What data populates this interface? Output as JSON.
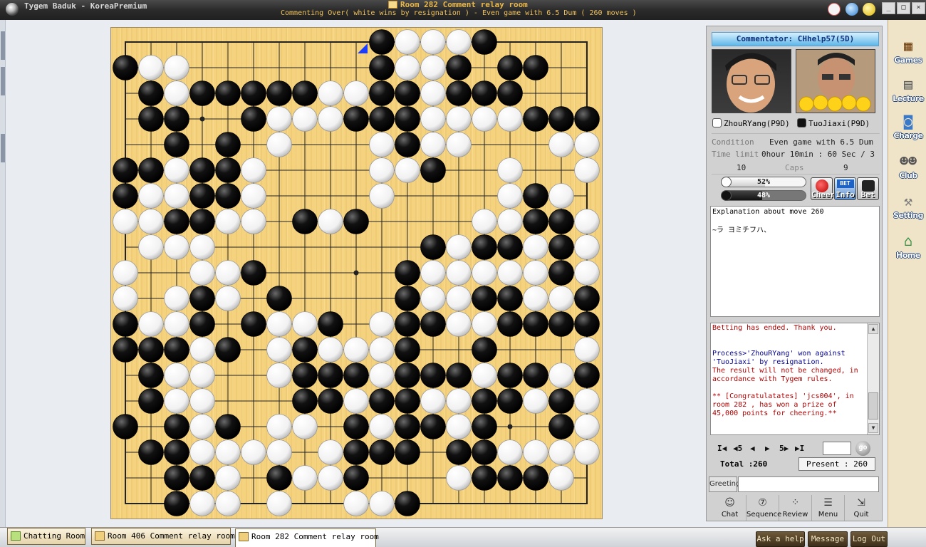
{
  "window": {
    "app_title": "Tygem Baduk - KoreaPremium",
    "room_title": "Room 282 Comment relay room",
    "room_subtitle": "Commenting Over( white wins by resignation ) - Even game with 6.5 Dum  ( 260 moves )"
  },
  "board": {
    "size": 19,
    "last_move": {
      "col": 9,
      "row": 0
    },
    "rows": [
      "..........BWWWB....",
      "BWW.......BWWB.BB..",
      ".BWBBBBBWWBBWBBB...",
      ".BB..BWWWBBBWWWWBBB",
      "..B.B.W...WBWW...WWB",
      "BBWBBW....WWB..W..WW",
      "BWWBBW....W....WBW..W",
      "WWBBWW.BWB....WWBBW..",
      ".WWW........BWBBWBW..",
      "W..WWB.....BWWWWWBWWW",
      "W.WBW.B....BWWBBWWBBWB",
      "BWWB.BWWB.WBBWWBBBBB",
      "BBBWB.WBWWWB..B...WB",
      ".BWW..WBBBWBBBWBBWB",
      ".BWW...BBWBBWWBBWBWW",
      "B.BWB.WW.BWBBWB..BW",
      ".BBWWWW.WBBB.BBWWWW",
      "..BBW.BWWB...WBBBW.",
      "..BWW.W..WWB......."
    ]
  },
  "panel": {
    "commentator": "Commentator: CHhelp57(5D)",
    "white_player": "ZhouRYang(P9D)",
    "black_player": "TuoJiaxi(P9D)",
    "condition_label": "Condition",
    "condition_value": "Even game with 6.5 Dum",
    "time_label": "Time limit",
    "time_value": "0hour 10min : 60 Sec / 3",
    "white_caps": "10",
    "caps_label": "Caps",
    "black_caps": "9",
    "white_bar_text": "52%",
    "white_bar_value": 52,
    "black_bar_text": "48%",
    "black_bar_value": 48,
    "cheer_label": "Cheer",
    "info_label": "Info",
    "info_badge": "BET",
    "bet_label": "Bet",
    "explanation_title": "Explanation about move 260",
    "explanation_text": "~ラ ヨミチフハ、",
    "chat": {
      "line1": "Betting has ended. Thank you.",
      "line2": "Process>'ZhouRYang' won against 'TuoJiaxi' by resignation.",
      "line3": "The result will not be changed, in accordance with Tygem rules.",
      "line4": "** [Congratulatates] 'jcs004', in room 282 , has won a prize of 45,000 points for cheering.**"
    },
    "nav": {
      "first": "I◀",
      "back5": "◀5",
      "prev": "◀",
      "next": "▶",
      "fwd5": "5▶",
      "last": "▶I",
      "go": "go"
    },
    "total": "Total :260",
    "present": "Present : 260",
    "greeting_label": "Greeting",
    "tools": [
      "Chat",
      "Sequence",
      "Review",
      "Menu",
      "Quit"
    ],
    "tool_icons": [
      "chat-icon",
      "sequence-icon",
      "review-icon",
      "menu-icon",
      "quit-icon"
    ]
  },
  "sidebar": {
    "games": "Games",
    "lecture": "Lecture",
    "charge": "Charge",
    "club": "Club",
    "setting": "Setting",
    "home": "Home"
  },
  "bottom": {
    "tab1": "Chatting Room",
    "tab2": "Room 406 Comment relay room",
    "tab3": "Room 282 Comment relay room",
    "ask_help": "Ask a help",
    "message": "Message",
    "logout": "Log Out"
  },
  "colors": {
    "board": "#f5d27e",
    "commentator_text": "#10327a",
    "chat_red": "#b00000",
    "chat_blue": "#000090",
    "last_move_marker": "#1a3cff"
  }
}
